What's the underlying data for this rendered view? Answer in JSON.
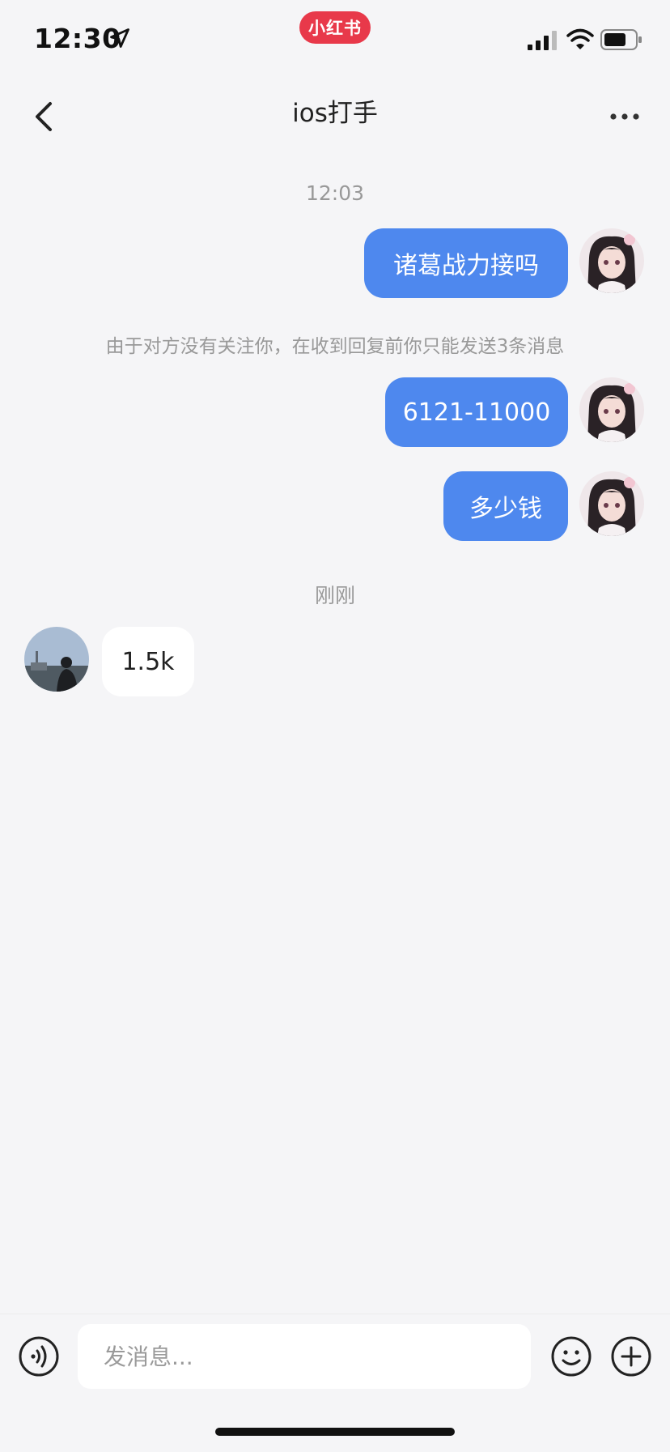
{
  "status_bar": {
    "time": "12:30",
    "app_badge": "小红书",
    "icons": [
      "location-arrow-icon",
      "signal-icon",
      "wifi-icon",
      "battery-icon"
    ]
  },
  "header": {
    "title": "ios打手",
    "back_icon": "chevron-left-icon",
    "more_icon": "more-dots-icon"
  },
  "conversation": {
    "time_1": "12:03",
    "msg_1": "诸葛战力接吗",
    "notice": "由于对方没有关注你，在收到回复前你只能发送3条消息",
    "msg_2": "6121-11000",
    "msg_3": "多少钱",
    "time_2": "刚刚",
    "reply_1": "1.5k"
  },
  "input_bar": {
    "placeholder": "发消息...",
    "voice_icon": "voice-icon",
    "emoji_icon": "emoji-icon",
    "plus_icon": "plus-circle-icon"
  },
  "colors": {
    "outgoing_bubble": "#4e88ee",
    "incoming_bubble": "#ffffff",
    "background": "#f5f5f7",
    "brand": "#e8394a"
  }
}
